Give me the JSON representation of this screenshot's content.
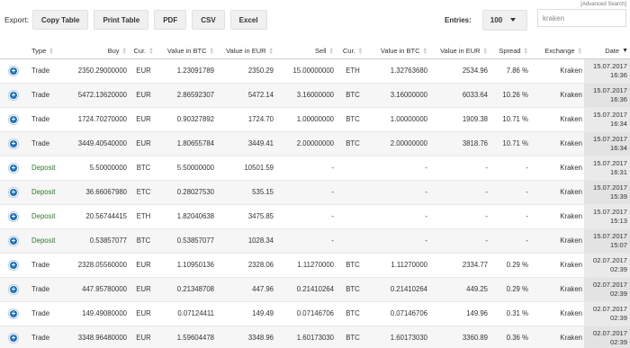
{
  "advanced_search": "[Advanced Search]",
  "toolbar": {
    "export_label": "Export:",
    "buttons": [
      "Copy Table",
      "Print Table",
      "PDF",
      "CSV",
      "Excel"
    ]
  },
  "entries": {
    "label": "Entries:",
    "value": "100"
  },
  "search": {
    "value": "kraken"
  },
  "columns": [
    "Type",
    "Buy",
    "Cur.",
    "Value in BTC",
    "Value in EUR",
    "Sell",
    "Cur.",
    "Value in BTC",
    "Value in EUR",
    "Spread",
    "Exchange",
    "Date"
  ],
  "rows": [
    {
      "type": "Trade",
      "buy": "2350.29000000",
      "buy_cur": "EUR",
      "buy_btc": "1.23091789",
      "buy_eur": "2350.29",
      "sell": "15.00000000",
      "sell_cur": "ETH",
      "sell_btc": "1.32763680",
      "sell_eur": "2534.96",
      "spread": "7.86 %",
      "exchange": "Kraken",
      "date": "15.07.2017",
      "time": "16:36"
    },
    {
      "type": "Trade",
      "buy": "5472.13620000",
      "buy_cur": "EUR",
      "buy_btc": "2.86592307",
      "buy_eur": "5472.14",
      "sell": "3.16000000",
      "sell_cur": "BTC",
      "sell_btc": "3.16000000",
      "sell_eur": "6033.64",
      "spread": "10.26 %",
      "exchange": "Kraken",
      "date": "15.07.2017",
      "time": "16:36"
    },
    {
      "type": "Trade",
      "buy": "1724.70270000",
      "buy_cur": "EUR",
      "buy_btc": "0.90327892",
      "buy_eur": "1724.70",
      "sell": "1.00000000",
      "sell_cur": "BTC",
      "sell_btc": "1.00000000",
      "sell_eur": "1909.38",
      "spread": "10.71 %",
      "exchange": "Kraken",
      "date": "15.07.2017",
      "time": "16:34"
    },
    {
      "type": "Trade",
      "buy": "3449.40540000",
      "buy_cur": "EUR",
      "buy_btc": "1.80655784",
      "buy_eur": "3449.41",
      "sell": "2.00000000",
      "sell_cur": "BTC",
      "sell_btc": "2.00000000",
      "sell_eur": "3818.76",
      "spread": "10.71 %",
      "exchange": "Kraken",
      "date": "15.07.2017",
      "time": "16:34"
    },
    {
      "type": "Deposit",
      "buy": "5.50000000",
      "buy_cur": "BTC",
      "buy_btc": "5.50000000",
      "buy_eur": "10501.59",
      "sell": "-",
      "sell_cur": "",
      "sell_btc": "-",
      "sell_eur": "-",
      "spread": "-",
      "exchange": "Kraken",
      "date": "15.07.2017",
      "time": "16:31"
    },
    {
      "type": "Deposit",
      "buy": "36.66067980",
      "buy_cur": "ETC",
      "buy_btc": "0.28027530",
      "buy_eur": "535.15",
      "sell": "-",
      "sell_cur": "",
      "sell_btc": "-",
      "sell_eur": "-",
      "spread": "-",
      "exchange": "Kraken",
      "date": "15.07.2017",
      "time": "15:39"
    },
    {
      "type": "Deposit",
      "buy": "20.56744415",
      "buy_cur": "ETH",
      "buy_btc": "1.82040638",
      "buy_eur": "3475.85",
      "sell": "-",
      "sell_cur": "",
      "sell_btc": "-",
      "sell_eur": "-",
      "spread": "-",
      "exchange": "Kraken",
      "date": "15.07.2017",
      "time": "15:13"
    },
    {
      "type": "Deposit",
      "buy": "0.53857077",
      "buy_cur": "BTC",
      "buy_btc": "0.53857077",
      "buy_eur": "1028.34",
      "sell": "-",
      "sell_cur": "",
      "sell_btc": "-",
      "sell_eur": "-",
      "spread": "-",
      "exchange": "Kraken",
      "date": "15.07.2017",
      "time": "15:07"
    },
    {
      "type": "Trade",
      "buy": "2328.05560000",
      "buy_cur": "EUR",
      "buy_btc": "1.10950136",
      "buy_eur": "2328.06",
      "sell": "1.11270000",
      "sell_cur": "BTC",
      "sell_btc": "1.11270000",
      "sell_eur": "2334.77",
      "spread": "0.29 %",
      "exchange": "Kraken",
      "date": "02.07.2017",
      "time": "02:39"
    },
    {
      "type": "Trade",
      "buy": "447.95780000",
      "buy_cur": "EUR",
      "buy_btc": "0.21348708",
      "buy_eur": "447.96",
      "sell": "0.21410264",
      "sell_cur": "BTC",
      "sell_btc": "0.21410264",
      "sell_eur": "449.25",
      "spread": "0.29 %",
      "exchange": "Kraken",
      "date": "02.07.2017",
      "time": "02:39"
    },
    {
      "type": "Trade",
      "buy": "149.49080000",
      "buy_cur": "EUR",
      "buy_btc": "0.07124411",
      "buy_eur": "149.49",
      "sell": "0.07146706",
      "sell_cur": "BTC",
      "sell_btc": "0.07146706",
      "sell_eur": "149.96",
      "spread": "0.31 %",
      "exchange": "Kraken",
      "date": "02.07.2017",
      "time": "02:39"
    },
    {
      "type": "Trade",
      "buy": "3348.96480000",
      "buy_cur": "EUR",
      "buy_btc": "1.59604478",
      "buy_eur": "3348.96",
      "sell": "1.60173030",
      "sell_cur": "BTC",
      "sell_btc": "1.60173030",
      "sell_eur": "3360.89",
      "spread": "0.36 %",
      "exchange": "Kraken",
      "date": "02.07.2017",
      "time": "02:39"
    }
  ],
  "colors": {
    "plus_button": "#1f6fb4",
    "deposit_text": "#2d7a2d"
  }
}
